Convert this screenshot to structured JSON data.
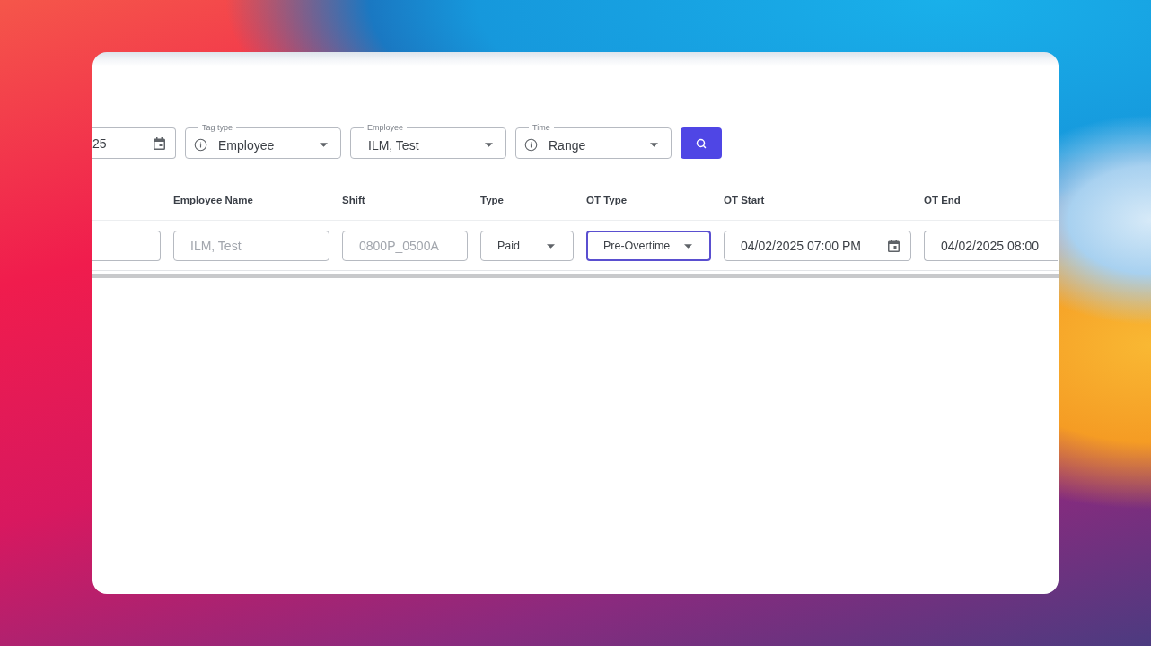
{
  "filters": [
    {
      "kind": "date",
      "value": "25",
      "cut_left": true
    },
    {
      "kind": "select",
      "label": "Tag type",
      "value": "Employee",
      "info_icon": true
    },
    {
      "kind": "select",
      "label": "Employee",
      "value": "ILM, Test",
      "info_icon": false
    },
    {
      "kind": "select",
      "label": "Time",
      "value": "Range",
      "info_icon": true
    },
    {
      "kind": "search"
    }
  ],
  "table": {
    "columns": [
      "",
      "Employee Name",
      "Shift",
      "Type",
      "OT Type",
      "OT Start",
      "OT End"
    ],
    "rows": [
      {
        "cells": [
          {
            "kind": "text_field",
            "cut_left": true
          },
          {
            "kind": "text_field",
            "value": "ILM, Test",
            "disabled": true
          },
          {
            "kind": "text_field",
            "value": "0800P_0500A",
            "disabled": true
          },
          {
            "kind": "select",
            "value": "Paid",
            "focused": false
          },
          {
            "kind": "select",
            "value": "Pre-Overtime",
            "focused": true
          },
          {
            "kind": "datetime",
            "value": "04/02/2025 07:00 PM",
            "cut_right": false
          },
          {
            "kind": "datetime",
            "value": "04/02/2025 08:00",
            "cut_right": true
          }
        ]
      }
    ]
  }
}
